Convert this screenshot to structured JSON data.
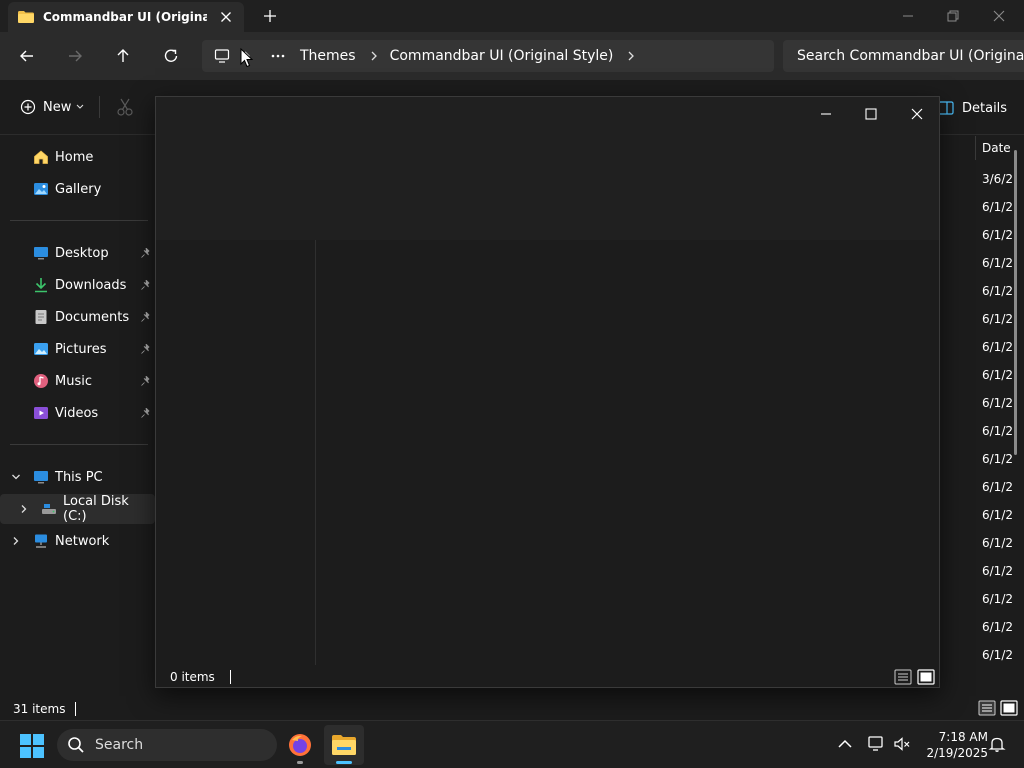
{
  "window": {
    "tab_title": "Commandbar UI (Original Style)",
    "new_tab_icon": "plus-icon",
    "controls": [
      "minimize-icon",
      "restore-icon",
      "close-icon"
    ]
  },
  "navigation": {
    "breadcrumbs": [
      "Themes",
      "Commandbar UI (Original Style)"
    ],
    "search_placeholder": "Search Commandbar UI (Original Style)"
  },
  "commandbar": {
    "new_label": "New",
    "details_label": "Details"
  },
  "sidebar": {
    "top_items": [
      {
        "label": "Home",
        "icon": "home-icon"
      },
      {
        "label": "Gallery",
        "icon": "gallery-icon"
      }
    ],
    "pinned_items": [
      {
        "label": "Desktop",
        "icon": "desktop-icon"
      },
      {
        "label": "Downloads",
        "icon": "downloads-icon"
      },
      {
        "label": "Documents",
        "icon": "documents-icon"
      },
      {
        "label": "Pictures",
        "icon": "pictures-icon"
      },
      {
        "label": "Music",
        "icon": "music-icon"
      },
      {
        "label": "Videos",
        "icon": "videos-icon"
      }
    ],
    "this_pc": "This PC",
    "local_disk": "Local Disk (C:)",
    "network": "Network"
  },
  "file_list": {
    "date_header": "Date",
    "dates": [
      "3/6/2",
      "6/1/2",
      "6/1/2",
      "6/1/2",
      "6/1/2",
      "6/1/2",
      "6/1/2",
      "6/1/2",
      "6/1/2",
      "6/1/2",
      "6/1/2",
      "6/1/2",
      "6/1/2",
      "6/1/2",
      "6/1/2",
      "6/1/2",
      "6/1/2",
      "6/1/2"
    ]
  },
  "overlay_window": {
    "status_text": "0 items",
    "controls": [
      "minimize-icon",
      "maximize-icon",
      "close-icon"
    ]
  },
  "statusbar": {
    "items_count": "31 items"
  },
  "taskbar": {
    "search_label": "Search",
    "time": "7:18 AM",
    "date": "2/19/2025",
    "accent": "#4cc2ff"
  }
}
